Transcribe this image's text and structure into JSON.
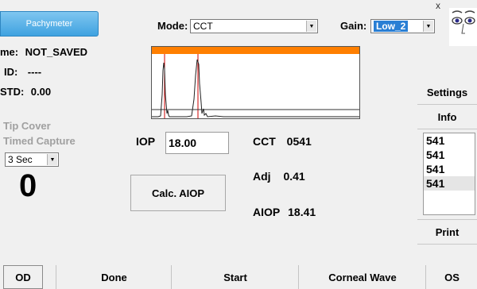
{
  "window": {
    "close_glyph": "x"
  },
  "tabs": {
    "pachymeter": "Pachymeter"
  },
  "mode": {
    "label": "Mode:",
    "value": "CCT"
  },
  "gain": {
    "label": "Gain:",
    "value": "Low_2"
  },
  "patient": {
    "name_label": "me:",
    "name_value": "NOT_SAVED",
    "id_label": "ID:",
    "id_value": "----",
    "std_label": "STD:",
    "std_value": "0.00"
  },
  "options": {
    "tip_cover": "Tip Cover",
    "timed_capture": "Timed Capture",
    "delay_value": "3 Sec",
    "counter": "0"
  },
  "iop": {
    "label": "IOP",
    "value": "18.00"
  },
  "calc_button": "Calc. AIOP",
  "results": {
    "cct_label": "CCT",
    "cct_value": "0541",
    "adj_label": "Adj",
    "adj_value": "0.41",
    "aiop_label": "AIOP",
    "aiop_value": "18.41"
  },
  "side": {
    "settings": "Settings",
    "info": "Info",
    "print": "Print"
  },
  "info_list": [
    "541",
    "541",
    "541",
    "541"
  ],
  "bottom": {
    "od": "OD",
    "done": "Done",
    "start": "Start",
    "corneal_wave": "Corneal Wave",
    "os": "OS"
  },
  "colors": {
    "accent_blue": "#3fa2e0",
    "wave_bar": "#ff7f00",
    "selection": "#2a7fd4"
  },
  "icons": {
    "logo": "eye-face-logo-icon"
  }
}
